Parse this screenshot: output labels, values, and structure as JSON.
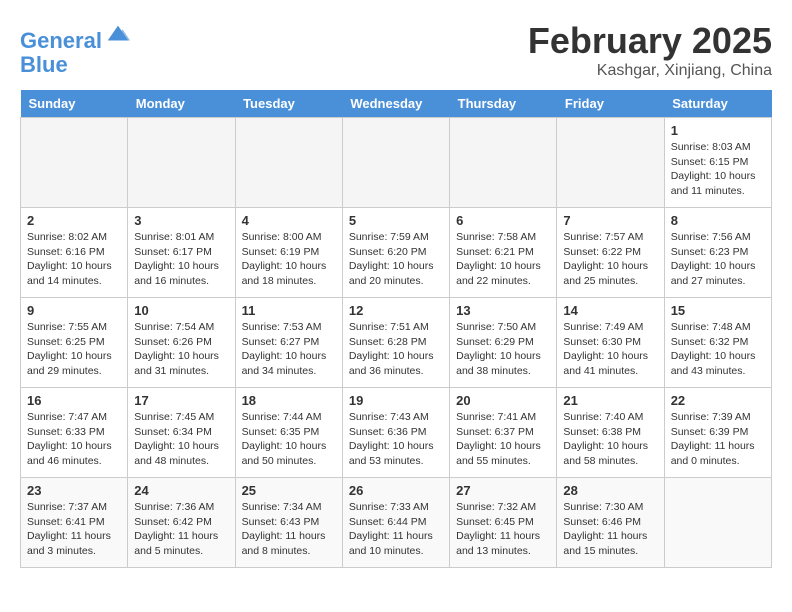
{
  "header": {
    "logo_line1": "General",
    "logo_line2": "Blue",
    "month": "February 2025",
    "location": "Kashgar, Xinjiang, China"
  },
  "weekdays": [
    "Sunday",
    "Monday",
    "Tuesday",
    "Wednesday",
    "Thursday",
    "Friday",
    "Saturday"
  ],
  "weeks": [
    [
      {
        "day": "",
        "info": ""
      },
      {
        "day": "",
        "info": ""
      },
      {
        "day": "",
        "info": ""
      },
      {
        "day": "",
        "info": ""
      },
      {
        "day": "",
        "info": ""
      },
      {
        "day": "",
        "info": ""
      },
      {
        "day": "1",
        "info": "Sunrise: 8:03 AM\nSunset: 6:15 PM\nDaylight: 10 hours\nand 11 minutes."
      }
    ],
    [
      {
        "day": "2",
        "info": "Sunrise: 8:02 AM\nSunset: 6:16 PM\nDaylight: 10 hours\nand 14 minutes."
      },
      {
        "day": "3",
        "info": "Sunrise: 8:01 AM\nSunset: 6:17 PM\nDaylight: 10 hours\nand 16 minutes."
      },
      {
        "day": "4",
        "info": "Sunrise: 8:00 AM\nSunset: 6:19 PM\nDaylight: 10 hours\nand 18 minutes."
      },
      {
        "day": "5",
        "info": "Sunrise: 7:59 AM\nSunset: 6:20 PM\nDaylight: 10 hours\nand 20 minutes."
      },
      {
        "day": "6",
        "info": "Sunrise: 7:58 AM\nSunset: 6:21 PM\nDaylight: 10 hours\nand 22 minutes."
      },
      {
        "day": "7",
        "info": "Sunrise: 7:57 AM\nSunset: 6:22 PM\nDaylight: 10 hours\nand 25 minutes."
      },
      {
        "day": "8",
        "info": "Sunrise: 7:56 AM\nSunset: 6:23 PM\nDaylight: 10 hours\nand 27 minutes."
      }
    ],
    [
      {
        "day": "9",
        "info": "Sunrise: 7:55 AM\nSunset: 6:25 PM\nDaylight: 10 hours\nand 29 minutes."
      },
      {
        "day": "10",
        "info": "Sunrise: 7:54 AM\nSunset: 6:26 PM\nDaylight: 10 hours\nand 31 minutes."
      },
      {
        "day": "11",
        "info": "Sunrise: 7:53 AM\nSunset: 6:27 PM\nDaylight: 10 hours\nand 34 minutes."
      },
      {
        "day": "12",
        "info": "Sunrise: 7:51 AM\nSunset: 6:28 PM\nDaylight: 10 hours\nand 36 minutes."
      },
      {
        "day": "13",
        "info": "Sunrise: 7:50 AM\nSunset: 6:29 PM\nDaylight: 10 hours\nand 38 minutes."
      },
      {
        "day": "14",
        "info": "Sunrise: 7:49 AM\nSunset: 6:30 PM\nDaylight: 10 hours\nand 41 minutes."
      },
      {
        "day": "15",
        "info": "Sunrise: 7:48 AM\nSunset: 6:32 PM\nDaylight: 10 hours\nand 43 minutes."
      }
    ],
    [
      {
        "day": "16",
        "info": "Sunrise: 7:47 AM\nSunset: 6:33 PM\nDaylight: 10 hours\nand 46 minutes."
      },
      {
        "day": "17",
        "info": "Sunrise: 7:45 AM\nSunset: 6:34 PM\nDaylight: 10 hours\nand 48 minutes."
      },
      {
        "day": "18",
        "info": "Sunrise: 7:44 AM\nSunset: 6:35 PM\nDaylight: 10 hours\nand 50 minutes."
      },
      {
        "day": "19",
        "info": "Sunrise: 7:43 AM\nSunset: 6:36 PM\nDaylight: 10 hours\nand 53 minutes."
      },
      {
        "day": "20",
        "info": "Sunrise: 7:41 AM\nSunset: 6:37 PM\nDaylight: 10 hours\nand 55 minutes."
      },
      {
        "day": "21",
        "info": "Sunrise: 7:40 AM\nSunset: 6:38 PM\nDaylight: 10 hours\nand 58 minutes."
      },
      {
        "day": "22",
        "info": "Sunrise: 7:39 AM\nSunset: 6:39 PM\nDaylight: 11 hours\nand 0 minutes."
      }
    ],
    [
      {
        "day": "23",
        "info": "Sunrise: 7:37 AM\nSunset: 6:41 PM\nDaylight: 11 hours\nand 3 minutes."
      },
      {
        "day": "24",
        "info": "Sunrise: 7:36 AM\nSunset: 6:42 PM\nDaylight: 11 hours\nand 5 minutes."
      },
      {
        "day": "25",
        "info": "Sunrise: 7:34 AM\nSunset: 6:43 PM\nDaylight: 11 hours\nand 8 minutes."
      },
      {
        "day": "26",
        "info": "Sunrise: 7:33 AM\nSunset: 6:44 PM\nDaylight: 11 hours\nand 10 minutes."
      },
      {
        "day": "27",
        "info": "Sunrise: 7:32 AM\nSunset: 6:45 PM\nDaylight: 11 hours\nand 13 minutes."
      },
      {
        "day": "28",
        "info": "Sunrise: 7:30 AM\nSunset: 6:46 PM\nDaylight: 11 hours\nand 15 minutes."
      },
      {
        "day": "",
        "info": ""
      }
    ]
  ]
}
